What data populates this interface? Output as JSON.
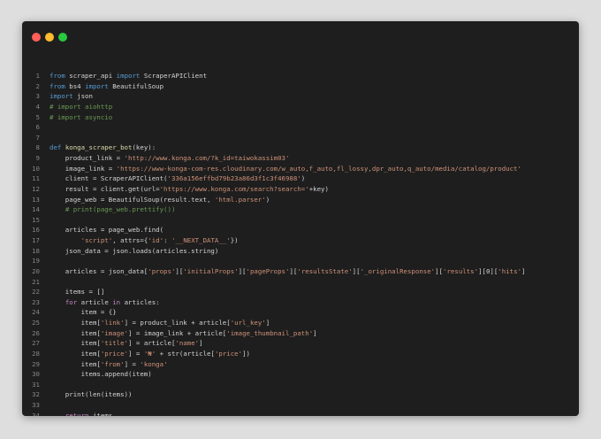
{
  "window": {
    "controls": {
      "close": "#ff5f57",
      "minimize": "#febc2e",
      "maximize": "#28c840"
    }
  },
  "lines": [
    [
      [
        "kw",
        "from"
      ],
      [
        "p",
        " scraper_api "
      ],
      [
        "kw",
        "import"
      ],
      [
        "p",
        " ScraperAPIClient"
      ]
    ],
    [
      [
        "kw",
        "from"
      ],
      [
        "p",
        " bs4 "
      ],
      [
        "kw",
        "import"
      ],
      [
        "p",
        " BeautifulSoup"
      ]
    ],
    [
      [
        "kw",
        "import"
      ],
      [
        "p",
        " json"
      ]
    ],
    [
      [
        "cm",
        "# import aiohttp"
      ]
    ],
    [
      [
        "cm",
        "# import asyncio"
      ]
    ],
    [],
    [],
    [
      [
        "kw",
        "def"
      ],
      [
        "p",
        " "
      ],
      [
        "fn",
        "konga_scraper_bot"
      ],
      [
        "p",
        "(key):"
      ]
    ],
    [
      [
        "p",
        "    product_link = "
      ],
      [
        "str",
        "'http://www.konga.com/?k_id=taiwokassim03'"
      ]
    ],
    [
      [
        "p",
        "    image_link = "
      ],
      [
        "str",
        "'https://www-konga-com-res.cloudinary.com/w_auto,f_auto,fl_lossy,dpr_auto,q_auto/media/catalog/product'"
      ]
    ],
    [
      [
        "p",
        "    client = ScraperAPIClient("
      ],
      [
        "str",
        "'336a156effbd79b23a86d3f1c3f46988'"
      ],
      [
        "p",
        ")"
      ]
    ],
    [
      [
        "p",
        "    result = client.get(url="
      ],
      [
        "str",
        "'https://www.konga.com/search?search='"
      ],
      [
        "p",
        "+key)"
      ]
    ],
    [
      [
        "p",
        "    page_web = BeautifulSoup(result.text, "
      ],
      [
        "str",
        "'html.parser'"
      ],
      [
        "p",
        ")"
      ]
    ],
    [
      [
        "p",
        "    "
      ],
      [
        "cm",
        "# print(page_web.prettify())"
      ]
    ],
    [],
    [
      [
        "p",
        "    articles = page_web.find("
      ]
    ],
    [
      [
        "p",
        "        "
      ],
      [
        "str",
        "'script'"
      ],
      [
        "p",
        ", attrs={"
      ],
      [
        "str",
        "'id'"
      ],
      [
        "p",
        ": "
      ],
      [
        "str",
        "'__NEXT_DATA__'"
      ],
      [
        "p",
        "})"
      ]
    ],
    [
      [
        "p",
        "    json_data = json.loads(articles.string)"
      ]
    ],
    [],
    [
      [
        "p",
        "    articles = json_data["
      ],
      [
        "str",
        "'props'"
      ],
      [
        "p",
        "]["
      ],
      [
        "str",
        "'initialProps'"
      ],
      [
        "p",
        "]["
      ],
      [
        "str",
        "'pageProps'"
      ],
      [
        "p",
        "]["
      ],
      [
        "str",
        "'resultsState'"
      ],
      [
        "p",
        "]["
      ],
      [
        "str",
        "'_originalResponse'"
      ],
      [
        "p",
        "]["
      ],
      [
        "str",
        "'results'"
      ],
      [
        "p",
        "][0]["
      ],
      [
        "str",
        "'hits'"
      ],
      [
        "p",
        "]"
      ]
    ],
    [],
    [
      [
        "p",
        "    items = []"
      ]
    ],
    [
      [
        "p",
        "    "
      ],
      [
        "ctl",
        "for"
      ],
      [
        "p",
        " article "
      ],
      [
        "ctl",
        "in"
      ],
      [
        "p",
        " articles:"
      ]
    ],
    [
      [
        "p",
        "        item = {}"
      ]
    ],
    [
      [
        "p",
        "        item["
      ],
      [
        "str",
        "'link'"
      ],
      [
        "p",
        "] = product_link + article["
      ],
      [
        "str",
        "'url_key'"
      ],
      [
        "p",
        "]"
      ]
    ],
    [
      [
        "p",
        "        item["
      ],
      [
        "str",
        "'image'"
      ],
      [
        "p",
        "] = image_link + article["
      ],
      [
        "str",
        "'image_thumbnail_path'"
      ],
      [
        "p",
        "]"
      ]
    ],
    [
      [
        "p",
        "        item["
      ],
      [
        "str",
        "'title'"
      ],
      [
        "p",
        "] = article["
      ],
      [
        "str",
        "'name'"
      ],
      [
        "p",
        "]"
      ]
    ],
    [
      [
        "p",
        "        item["
      ],
      [
        "str",
        "'price'"
      ],
      [
        "p",
        "] = "
      ],
      [
        "str",
        "'₦'"
      ],
      [
        "p",
        " + str(article["
      ],
      [
        "str",
        "'price'"
      ],
      [
        "p",
        "])"
      ]
    ],
    [
      [
        "p",
        "        item["
      ],
      [
        "str",
        "'from'"
      ],
      [
        "p",
        "] = "
      ],
      [
        "str",
        "'konga'"
      ]
    ],
    [
      [
        "p",
        "        items.append(item)"
      ]
    ],
    [],
    [
      [
        "p",
        "    print(len(items))"
      ]
    ],
    [],
    [
      [
        "p",
        "    "
      ],
      [
        "ctl",
        "return"
      ],
      [
        "p",
        " items"
      ]
    ]
  ]
}
